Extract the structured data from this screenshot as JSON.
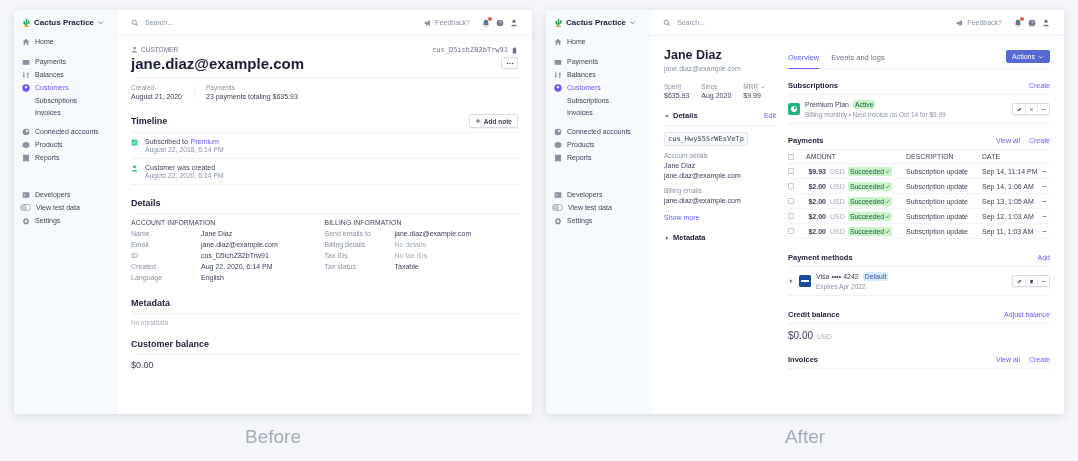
{
  "screens": [
    {
      "kind": "detail",
      "caption": "Before",
      "sidebar": {
        "account": "Cactus Practice",
        "groups": [
          [
            {
              "label": "Home",
              "selected": false
            }
          ],
          [
            {
              "label": "Payments",
              "selected": false
            },
            {
              "label": "Balances",
              "selected": false
            },
            {
              "label": "Customers",
              "selected": true,
              "children": [
                {
                  "label": "Subscriptions",
                  "selected": false
                },
                {
                  "label": "Invoices",
                  "selected": false
                }
              ]
            }
          ],
          [
            {
              "label": "Connected accounts",
              "selected": false
            },
            {
              "label": "Products",
              "selected": false
            },
            {
              "label": "Reports",
              "selected": false
            }
          ],
          [
            {
              "kind": "link",
              "label": "Developers",
              "selected": false
            },
            {
              "kind": "toggle",
              "label": "View test data",
              "on": false
            },
            {
              "kind": "link",
              "label": "Settings",
              "selected": false
            }
          ]
        ]
      },
      "topbar": {
        "search_placeholder": "Search...",
        "feedback": "Feedback?",
        "unread": true
      },
      "header": {
        "eyebrow": "CUSTOMER",
        "id": "cus_D5ichZ82bTrw91",
        "title": "jane.diaz@example.com"
      },
      "stats": [
        {
          "label": "Created",
          "value": "August 21, 2020"
        },
        {
          "label": "Payments",
          "value": "23 payments totaling $635.93"
        }
      ],
      "timeline": {
        "title": "Timeline",
        "button": "Add note",
        "events": [
          {
            "kind": "subscription",
            "text": "Subscribed to",
            "link": "Premium",
            "time": "August 22, 2018, 6:14 PM"
          },
          {
            "kind": "customer",
            "text": "Customer was created",
            "time": "August 22, 2020, 6:14 PM"
          }
        ]
      },
      "details": {
        "title": "Details",
        "columns": [
          {
            "heading": "ACCOUNT INFORMATION",
            "rows": [
              {
                "label": "Name",
                "value": "Jane Diaz",
                "muted": false
              },
              {
                "label": "Email",
                "value": "jane.diaz@example.com",
                "muted": false
              },
              {
                "label": "ID",
                "value": "cus_D5ichZ82bTrw91",
                "muted": false
              },
              {
                "label": "Created",
                "value": "Aug 22, 2020, 6:14 PM",
                "muted": false
              },
              {
                "label": "Language",
                "value": "English",
                "muted": false
              }
            ]
          },
          {
            "heading": "BILLING INFORMATION",
            "rows": [
              {
                "label": "Send emails to",
                "value": "jane.diaz@example.com",
                "muted": false
              },
              {
                "label": "Billing details",
                "value": "No details",
                "muted": true
              },
              {
                "label": "Tax IDs",
                "value": "No tax IDs",
                "muted": true
              },
              {
                "label": "Tax status",
                "value": "Taxable",
                "muted": false
              }
            ]
          }
        ]
      },
      "metadata": {
        "title": "Metadata",
        "empty_text": "No metadata"
      },
      "balance": {
        "title": "Customer balance",
        "amount": "$0.00"
      }
    },
    {
      "kind": "overview",
      "caption": "After",
      "sidebar": {
        "account": "Cactus Practice",
        "groups": [
          [
            {
              "label": "Home",
              "selected": false
            }
          ],
          [
            {
              "label": "Payments",
              "selected": false
            },
            {
              "label": "Balances",
              "selected": false
            },
            {
              "label": "Customers",
              "selected": true,
              "children": [
                {
                  "label": "Subscriptions",
                  "selected": false
                },
                {
                  "label": "Invoices",
                  "selected": false
                }
              ]
            }
          ],
          [
            {
              "label": "Connected accounts",
              "selected": false
            },
            {
              "label": "Products",
              "selected": false
            },
            {
              "label": "Reports",
              "selected": false
            }
          ],
          [
            {
              "kind": "link",
              "label": "Developers",
              "selected": false
            },
            {
              "kind": "toggle",
              "label": "View test data",
              "on": false
            },
            {
              "kind": "link",
              "label": "Settings",
              "selected": false
            }
          ]
        ]
      },
      "topbar": {
        "search_placeholder": "Search...",
        "feedback": "Feedback?",
        "unread": true
      },
      "profile": {
        "name": "Jane Diaz",
        "email": "jane.diaz@example.com",
        "stats": [
          {
            "label": "Spent",
            "value": "$635.93",
            "dropdown": false
          },
          {
            "label": "Since",
            "value": "Aug 2020",
            "dropdown": false
          },
          {
            "label": "MRR",
            "value": "$9.99",
            "dropdown": true
          }
        ]
      },
      "details": {
        "title": "Details",
        "expanded": true,
        "action": "Edit",
        "id": "cus_HwyS5SrWEsVeTp",
        "groups": [
          {
            "label": "Account details",
            "lines": [
              "Jane Diaz",
              "jane.diaz@example.com"
            ]
          },
          {
            "label": "Billing emails",
            "lines": [
              "jane.diaz@example.com"
            ]
          }
        ],
        "more": "Show more"
      },
      "metadata": {
        "title": "Metadata",
        "expanded": false
      },
      "tabs": [
        {
          "label": "Overview",
          "selected": true
        },
        {
          "label": "Events and logs",
          "selected": false
        }
      ],
      "actions_button": "Actions",
      "subscriptions": {
        "title": "Subscriptions",
        "links": [
          "Create"
        ],
        "items": [
          {
            "name": "Premium Plan",
            "status": "Active",
            "detail": "Billing monthly • Next invoice on Oct 14 for $9.99"
          }
        ]
      },
      "payments": {
        "title": "Payments",
        "links": [
          "View all",
          "Create"
        ],
        "all_checked": false,
        "columns": [
          "AMOUNT",
          "DESCRIPTION",
          "DATE"
        ],
        "rows": [
          {
            "checked": false,
            "amount": "$9.93",
            "currency": "USD",
            "status": "Succeeded",
            "description": "Subscription update",
            "date": "Sep 14, 11:14 PM"
          },
          {
            "checked": false,
            "amount": "$2.00",
            "currency": "USD",
            "status": "Succeeded",
            "description": "Subscription update",
            "date": "Sep 14, 1:06 AM"
          },
          {
            "checked": false,
            "amount": "$2.00",
            "currency": "USD",
            "status": "Succeeded",
            "description": "Subscription update",
            "date": "Sep 13, 1:05 AM"
          },
          {
            "checked": false,
            "amount": "$2.00",
            "currency": "USD",
            "status": "Succeeded",
            "description": "Subscription update",
            "date": "Sep 12, 1:03 AM"
          },
          {
            "checked": false,
            "amount": "$2.00",
            "currency": "USD",
            "status": "Succeeded",
            "description": "Subscription update",
            "date": "Sep 11, 1:03 AM"
          }
        ]
      },
      "payment_methods": {
        "title": "Payment methods",
        "links": [
          "Add"
        ],
        "items": [
          {
            "expanded": false,
            "name": "Visa •••• 4242",
            "badge": "Default",
            "detail": "Expires Apr 2022"
          }
        ]
      },
      "credit_balance": {
        "title": "Credit balance",
        "links": [
          "Adjust balance"
        ],
        "amount": "$0.00",
        "currency": "USD"
      },
      "invoices": {
        "title": "Invoices",
        "links": [
          "View all",
          "Create"
        ]
      }
    }
  ]
}
